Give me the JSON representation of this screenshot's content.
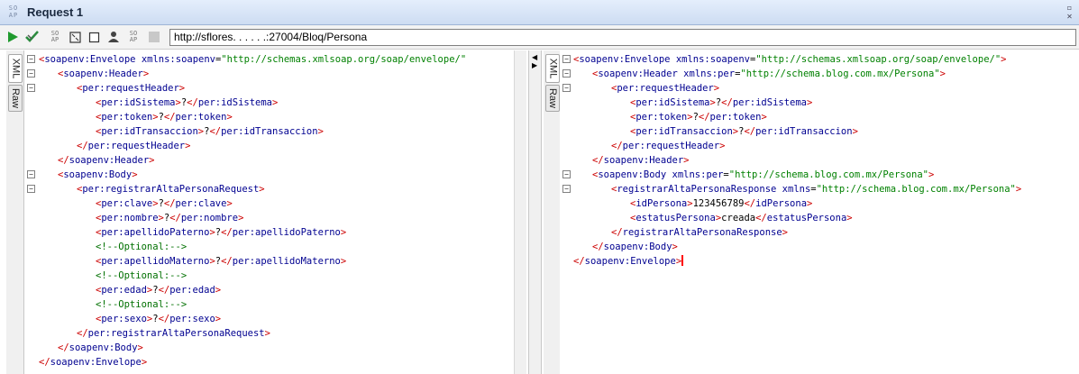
{
  "window": {
    "logo_text": "SO\nAP",
    "title": "Request 1"
  },
  "toolbar": {
    "url": "http://sflores.  .  .  .  .  .:27004/Bloq/Persona",
    "icons": [
      "play-icon",
      "validate-icon",
      "soap-icon",
      "fullscreen-icon",
      "stop-icon",
      "user-icon",
      "soap-config-icon",
      "disabled-icon"
    ]
  },
  "left_tabs": {
    "xml": "XML",
    "raw": "Raw"
  },
  "right_tabs": {
    "xml": "XML",
    "raw": "Raw"
  },
  "request_lines": [
    {
      "fold": "−",
      "parts": [
        [
          "b",
          "<"
        ],
        [
          "t",
          "soapenv:Envelope"
        ],
        [
          "tx",
          " "
        ],
        [
          "an",
          "xmlns:soapenv"
        ],
        [
          "tx",
          "="
        ],
        [
          "av",
          "\"http://schemas.xmlsoap.org/soap/envelope/\""
        ]
      ],
      "indent": 0
    },
    {
      "fold": "−",
      "parts": [
        [
          "b",
          "<"
        ],
        [
          "t",
          "soapenv:Header"
        ],
        [
          "b",
          ">"
        ]
      ],
      "indent": 1
    },
    {
      "fold": "−",
      "parts": [
        [
          "b",
          "<"
        ],
        [
          "t",
          "per:requestHeader"
        ],
        [
          "b",
          ">"
        ]
      ],
      "indent": 2
    },
    {
      "fold": "",
      "parts": [
        [
          "b",
          "<"
        ],
        [
          "t",
          "per:idSistema"
        ],
        [
          "b",
          ">"
        ],
        [
          "tx",
          "?"
        ],
        [
          "b",
          "</"
        ],
        [
          "t",
          "per:idSistema"
        ],
        [
          "b",
          ">"
        ]
      ],
      "indent": 3
    },
    {
      "fold": "",
      "parts": [
        [
          "b",
          "<"
        ],
        [
          "t",
          "per:token"
        ],
        [
          "b",
          ">"
        ],
        [
          "tx",
          "?"
        ],
        [
          "b",
          "</"
        ],
        [
          "t",
          "per:token"
        ],
        [
          "b",
          ">"
        ]
      ],
      "indent": 3
    },
    {
      "fold": "",
      "parts": [
        [
          "b",
          "<"
        ],
        [
          "t",
          "per:idTransaccion"
        ],
        [
          "b",
          ">"
        ],
        [
          "tx",
          "?"
        ],
        [
          "b",
          "</"
        ],
        [
          "t",
          "per:idTransaccion"
        ],
        [
          "b",
          ">"
        ]
      ],
      "indent": 3
    },
    {
      "fold": "",
      "parts": [
        [
          "b",
          "</"
        ],
        [
          "t",
          "per:requestHeader"
        ],
        [
          "b",
          ">"
        ]
      ],
      "indent": 2
    },
    {
      "fold": "",
      "parts": [
        [
          "b",
          "</"
        ],
        [
          "t",
          "soapenv:Header"
        ],
        [
          "b",
          ">"
        ]
      ],
      "indent": 1
    },
    {
      "fold": "−",
      "parts": [
        [
          "b",
          "<"
        ],
        [
          "t",
          "soapenv:Body"
        ],
        [
          "b",
          ">"
        ]
      ],
      "indent": 1
    },
    {
      "fold": "−",
      "parts": [
        [
          "b",
          "<"
        ],
        [
          "t",
          "per:registrarAltaPersonaRequest"
        ],
        [
          "b",
          ">"
        ]
      ],
      "indent": 2
    },
    {
      "fold": "",
      "parts": [
        [
          "b",
          "<"
        ],
        [
          "t",
          "per:clave"
        ],
        [
          "b",
          ">"
        ],
        [
          "tx",
          "?"
        ],
        [
          "b",
          "</"
        ],
        [
          "t",
          "per:clave"
        ],
        [
          "b",
          ">"
        ]
      ],
      "indent": 3
    },
    {
      "fold": "",
      "parts": [
        [
          "b",
          "<"
        ],
        [
          "t",
          "per:nombre"
        ],
        [
          "b",
          ">"
        ],
        [
          "tx",
          "?"
        ],
        [
          "b",
          "</"
        ],
        [
          "t",
          "per:nombre"
        ],
        [
          "b",
          ">"
        ]
      ],
      "indent": 3
    },
    {
      "fold": "",
      "parts": [
        [
          "b",
          "<"
        ],
        [
          "t",
          "per:apellidoPaterno"
        ],
        [
          "b",
          ">"
        ],
        [
          "tx",
          "?"
        ],
        [
          "b",
          "</"
        ],
        [
          "t",
          "per:apellidoPaterno"
        ],
        [
          "b",
          ">"
        ]
      ],
      "indent": 3
    },
    {
      "fold": "",
      "parts": [
        [
          "cm",
          "<!--Optional:-->"
        ]
      ],
      "indent": 3
    },
    {
      "fold": "",
      "parts": [
        [
          "b",
          "<"
        ],
        [
          "t",
          "per:apellidoMaterno"
        ],
        [
          "b",
          ">"
        ],
        [
          "tx",
          "?"
        ],
        [
          "b",
          "</"
        ],
        [
          "t",
          "per:apellidoMaterno"
        ],
        [
          "b",
          ">"
        ]
      ],
      "indent": 3
    },
    {
      "fold": "",
      "parts": [
        [
          "cm",
          "<!--Optional:-->"
        ]
      ],
      "indent": 3
    },
    {
      "fold": "",
      "parts": [
        [
          "b",
          "<"
        ],
        [
          "t",
          "per:edad"
        ],
        [
          "b",
          ">"
        ],
        [
          "tx",
          "?"
        ],
        [
          "b",
          "</"
        ],
        [
          "t",
          "per:edad"
        ],
        [
          "b",
          ">"
        ]
      ],
      "indent": 3
    },
    {
      "fold": "",
      "parts": [
        [
          "cm",
          "<!--Optional:-->"
        ]
      ],
      "indent": 3
    },
    {
      "fold": "",
      "parts": [
        [
          "b",
          "<"
        ],
        [
          "t",
          "per:sexo"
        ],
        [
          "b",
          ">"
        ],
        [
          "tx",
          "?"
        ],
        [
          "b",
          "</"
        ],
        [
          "t",
          "per:sexo"
        ],
        [
          "b",
          ">"
        ]
      ],
      "indent": 3
    },
    {
      "fold": "",
      "parts": [
        [
          "b",
          "</"
        ],
        [
          "t",
          "per:registrarAltaPersonaRequest"
        ],
        [
          "b",
          ">"
        ]
      ],
      "indent": 2
    },
    {
      "fold": "",
      "parts": [
        [
          "b",
          "</"
        ],
        [
          "t",
          "soapenv:Body"
        ],
        [
          "b",
          ">"
        ]
      ],
      "indent": 1
    },
    {
      "fold": "",
      "parts": [
        [
          "b",
          "</"
        ],
        [
          "t",
          "soapenv:Envelope"
        ],
        [
          "b",
          ">"
        ]
      ],
      "indent": 0
    }
  ],
  "response_lines": [
    {
      "fold": "−",
      "parts": [
        [
          "b",
          "<"
        ],
        [
          "t",
          "soapenv:Envelope"
        ],
        [
          "tx",
          " "
        ],
        [
          "an",
          "xmlns:soapenv"
        ],
        [
          "tx",
          "="
        ],
        [
          "av",
          "\"http://schemas.xmlsoap.org/soap/envelope/\""
        ],
        [
          "b",
          ">"
        ]
      ],
      "indent": 0
    },
    {
      "fold": "−",
      "parts": [
        [
          "b",
          "<"
        ],
        [
          "t",
          "soapenv:Header"
        ],
        [
          "tx",
          " "
        ],
        [
          "an",
          "xmlns:per"
        ],
        [
          "tx",
          "="
        ],
        [
          "av",
          "\"http://schema.blog.com.mx/Persona\""
        ],
        [
          "b",
          ">"
        ]
      ],
      "indent": 1
    },
    {
      "fold": "−",
      "parts": [
        [
          "b",
          "<"
        ],
        [
          "t",
          "per:requestHeader"
        ],
        [
          "b",
          ">"
        ]
      ],
      "indent": 2
    },
    {
      "fold": "",
      "parts": [
        [
          "b",
          "<"
        ],
        [
          "t",
          "per:idSistema"
        ],
        [
          "b",
          ">"
        ],
        [
          "tx",
          "?"
        ],
        [
          "b",
          "</"
        ],
        [
          "t",
          "per:idSistema"
        ],
        [
          "b",
          ">"
        ]
      ],
      "indent": 3
    },
    {
      "fold": "",
      "parts": [
        [
          "b",
          "<"
        ],
        [
          "t",
          "per:token"
        ],
        [
          "b",
          ">"
        ],
        [
          "tx",
          "?"
        ],
        [
          "b",
          "</"
        ],
        [
          "t",
          "per:token"
        ],
        [
          "b",
          ">"
        ]
      ],
      "indent": 3
    },
    {
      "fold": "",
      "parts": [
        [
          "b",
          "<"
        ],
        [
          "t",
          "per:idTransaccion"
        ],
        [
          "b",
          ">"
        ],
        [
          "tx",
          "?"
        ],
        [
          "b",
          "</"
        ],
        [
          "t",
          "per:idTransaccion"
        ],
        [
          "b",
          ">"
        ]
      ],
      "indent": 3
    },
    {
      "fold": "",
      "parts": [
        [
          "b",
          "</"
        ],
        [
          "t",
          "per:requestHeader"
        ],
        [
          "b",
          ">"
        ]
      ],
      "indent": 2
    },
    {
      "fold": "",
      "parts": [
        [
          "b",
          "</"
        ],
        [
          "t",
          "soapenv:Header"
        ],
        [
          "b",
          ">"
        ]
      ],
      "indent": 1
    },
    {
      "fold": "−",
      "parts": [
        [
          "b",
          "<"
        ],
        [
          "t",
          "soapenv:Body"
        ],
        [
          "tx",
          " "
        ],
        [
          "an",
          "xmlns:per"
        ],
        [
          "tx",
          "="
        ],
        [
          "av",
          "\"http://schema.blog.com.mx/Persona\""
        ],
        [
          "b",
          ">"
        ]
      ],
      "indent": 1
    },
    {
      "fold": "−",
      "parts": [
        [
          "b",
          "<"
        ],
        [
          "t",
          "registrarAltaPersonaResponse"
        ],
        [
          "tx",
          " "
        ],
        [
          "an",
          "xmlns"
        ],
        [
          "tx",
          "="
        ],
        [
          "av",
          "\"http://schema.blog.com.mx/Persona\""
        ],
        [
          "b",
          ">"
        ]
      ],
      "indent": 2
    },
    {
      "fold": "",
      "parts": [
        [
          "b",
          "<"
        ],
        [
          "t",
          "idPersona"
        ],
        [
          "b",
          ">"
        ],
        [
          "tx",
          "123456789"
        ],
        [
          "b",
          "</"
        ],
        [
          "t",
          "idPersona"
        ],
        [
          "b",
          ">"
        ]
      ],
      "indent": 3
    },
    {
      "fold": "",
      "parts": [
        [
          "b",
          "<"
        ],
        [
          "t",
          "estatusPersona"
        ],
        [
          "b",
          ">"
        ],
        [
          "tx",
          "creada"
        ],
        [
          "b",
          "</"
        ],
        [
          "t",
          "estatusPersona"
        ],
        [
          "b",
          ">"
        ]
      ],
      "indent": 3
    },
    {
      "fold": "",
      "parts": [
        [
          "b",
          "</"
        ],
        [
          "t",
          "registrarAltaPersonaResponse"
        ],
        [
          "b",
          ">"
        ]
      ],
      "indent": 2
    },
    {
      "fold": "",
      "parts": [
        [
          "b",
          "</"
        ],
        [
          "t",
          "soapenv:Body"
        ],
        [
          "b",
          ">"
        ]
      ],
      "indent": 1
    },
    {
      "fold": "",
      "parts": [
        [
          "b",
          "</"
        ],
        [
          "t",
          "soapenv:Envelope"
        ],
        [
          "b",
          ">"
        ]
      ],
      "indent": 0,
      "cursor": true
    }
  ],
  "colors": {
    "tag": "#000090",
    "bracket": "#cc0000",
    "attr_value": "#008000",
    "comment": "#007000",
    "titlebar": "#cddcf2"
  }
}
